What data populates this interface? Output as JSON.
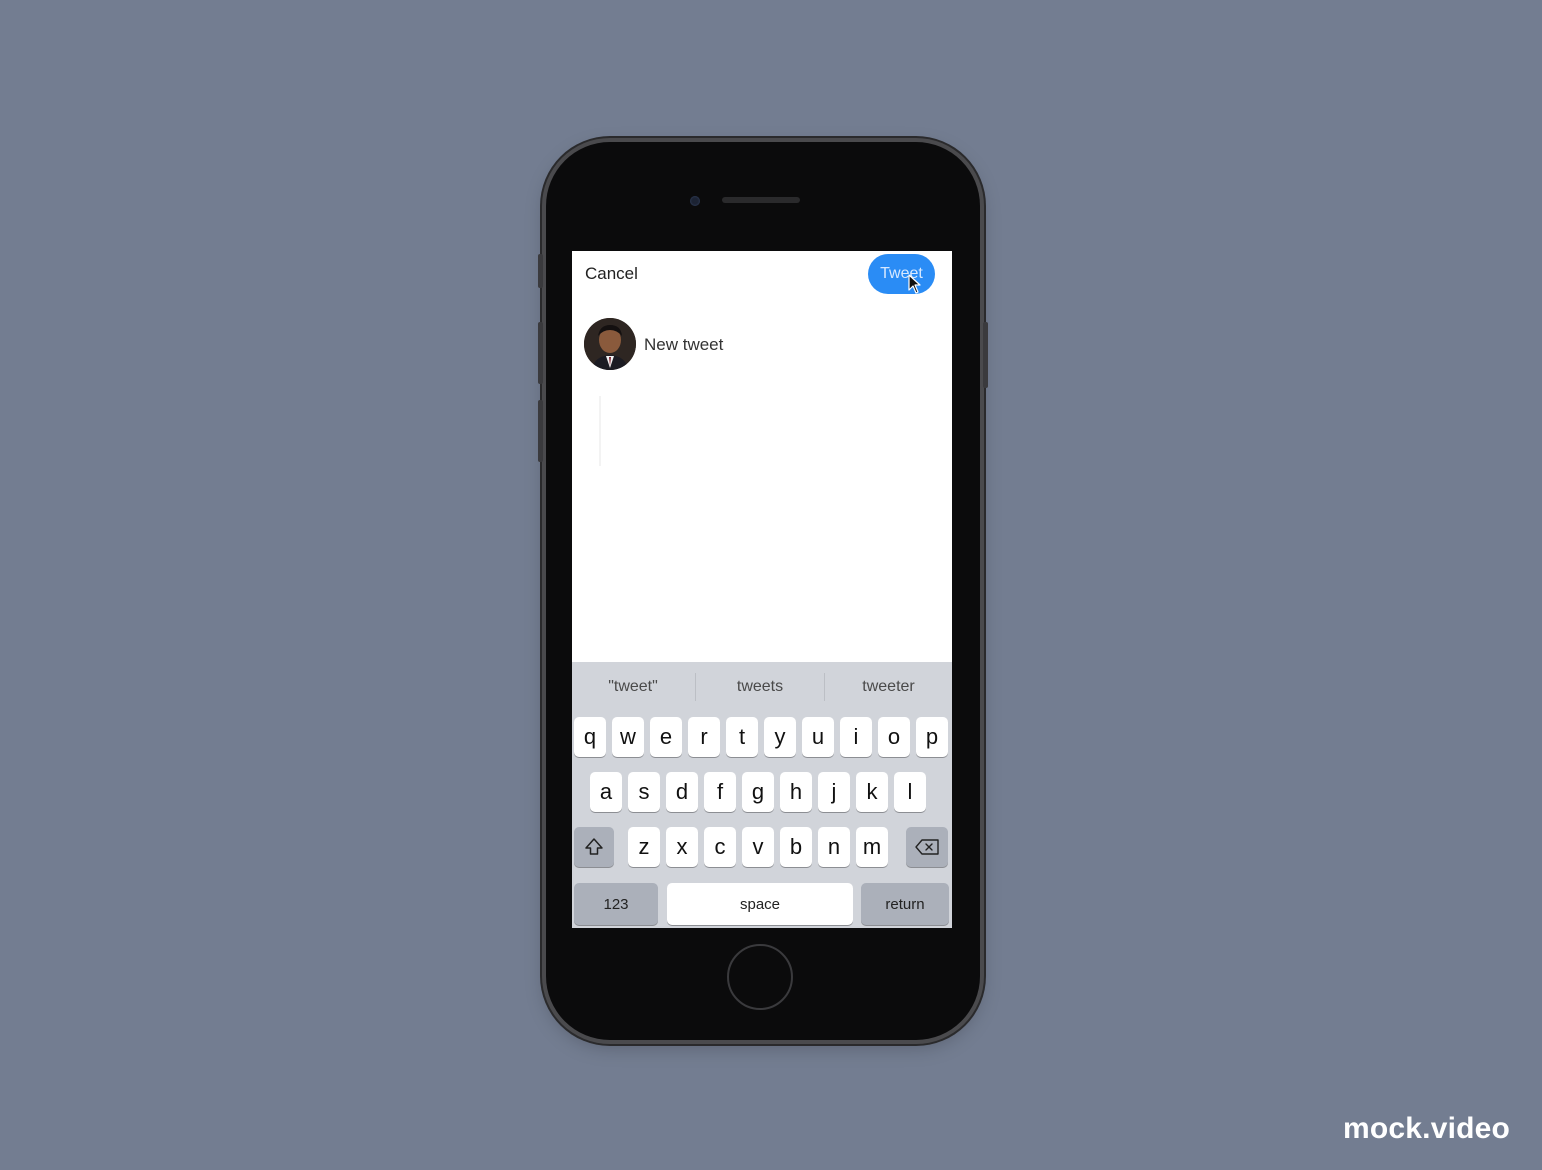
{
  "compose": {
    "cancel_label": "Cancel",
    "tweet_button_label": "Tweet",
    "input_text": "New tweet"
  },
  "keyboard": {
    "suggestions": [
      "\"tweet\"",
      "tweets",
      "tweeter"
    ],
    "row1": [
      "q",
      "w",
      "e",
      "r",
      "t",
      "y",
      "u",
      "i",
      "o",
      "p"
    ],
    "row2": [
      "a",
      "s",
      "d",
      "f",
      "g",
      "h",
      "j",
      "k",
      "l"
    ],
    "row3": [
      "z",
      "x",
      "c",
      "v",
      "b",
      "n",
      "m"
    ],
    "numbers_label": "123",
    "space_label": "space",
    "return_label": "return",
    "shift_icon": "shift-icon",
    "delete_icon": "backspace-icon"
  },
  "watermark": "mock.video",
  "colors": {
    "background": "#737d91",
    "tweet_button": "#2a8cf5"
  }
}
